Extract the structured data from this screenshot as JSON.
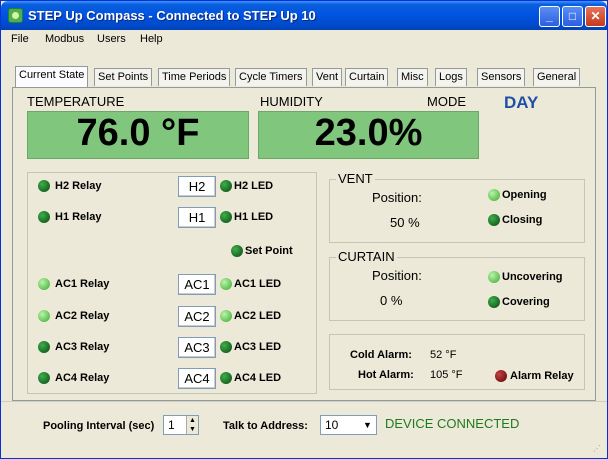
{
  "window": {
    "title": "STEP Up Compass - Connected to STEP Up 10"
  },
  "menu": [
    "File",
    "Modbus",
    "Users",
    "Help"
  ],
  "tabs": [
    "Current State",
    "Set Points",
    "Time Periods",
    "Cycle Timers",
    "Vent",
    "Curtain",
    "Misc",
    "Logs",
    "Sensors",
    "General"
  ],
  "labels": {
    "temperature": "TEMPERATURE",
    "humidity": "HUMIDITY",
    "mode": "MODE"
  },
  "readouts": {
    "temperature": "76.0 °F",
    "humidity": "23.0%",
    "mode": "DAY"
  },
  "relays": [
    {
      "relay": "H2 Relay",
      "button": "H2",
      "led": "H2 LED",
      "relay_state": "on",
      "led_state": "on"
    },
    {
      "relay": "H1 Relay",
      "button": "H1",
      "led": "H1 LED",
      "relay_state": "on",
      "led_state": "on"
    },
    {
      "relay": "AC1 Relay",
      "button": "AC1",
      "led": "AC1 LED",
      "relay_state": "off",
      "led_state": "off"
    },
    {
      "relay": "AC2 Relay",
      "button": "AC2",
      "led": "AC2 LED",
      "relay_state": "off",
      "led_state": "off"
    },
    {
      "relay": "AC3 Relay",
      "button": "AC3",
      "led": "AC3 LED",
      "relay_state": "on",
      "led_state": "on"
    },
    {
      "relay": "AC4 Relay",
      "button": "AC4",
      "led": "AC4 LED",
      "relay_state": "on",
      "led_state": "on"
    }
  ],
  "setpoint": {
    "label": "Set Point",
    "state": "on"
  },
  "vent": {
    "title": "VENT",
    "position_label": "Position:",
    "position": "50 %",
    "opening": "Opening",
    "closing": "Closing",
    "opening_state": "off",
    "closing_state": "on"
  },
  "curtain": {
    "title": "CURTAIN",
    "position_label": "Position:",
    "position": "0 %",
    "uncovering": "Uncovering",
    "covering": "Covering",
    "uncovering_state": "off",
    "covering_state": "on"
  },
  "alarm": {
    "cold_label": "Cold Alarm:",
    "cold_value": "52 °F",
    "hot_label": "Hot Alarm:",
    "hot_value": "105 °F",
    "relay_label": "Alarm Relay",
    "relay_state": "alarm"
  },
  "status": {
    "pooling_label": "Pooling Interval (sec)",
    "pooling_value": "1",
    "address_label": "Talk to Address:",
    "address_value": "10",
    "connection": "DEVICE CONNECTED"
  },
  "colors": {
    "readout_bg": "#80c67c",
    "mode_text": "#1f4fa8",
    "connected_text": "#1e7a1e",
    "led_on": "#1b7a26",
    "led_off": "#8ee07a",
    "alarm_led": "#8b1a1a"
  }
}
